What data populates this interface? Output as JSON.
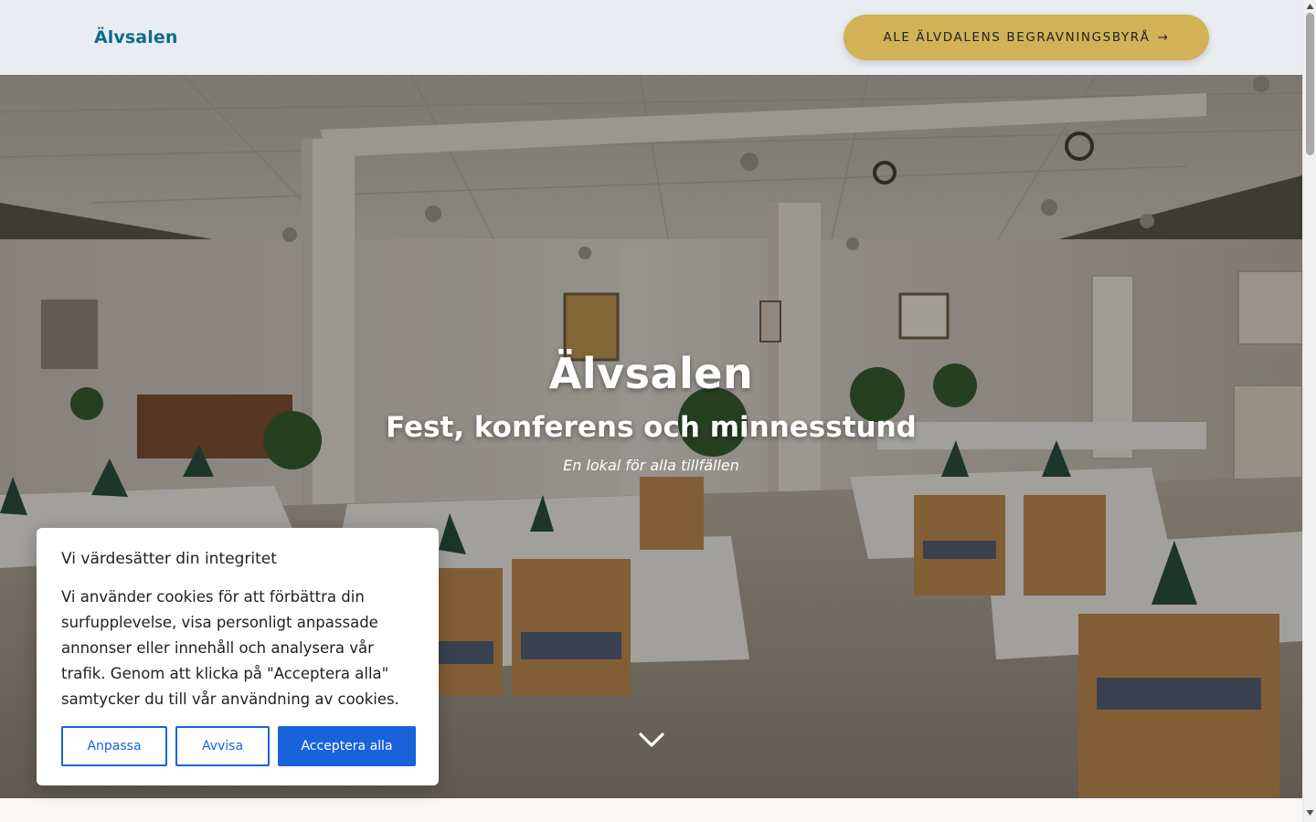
{
  "header": {
    "logo": "Älvsalen",
    "cta_label": "ALE ÄLVDALENS BEGRAVNINGSBYRÅ",
    "cta_arrow": "→",
    "cta_color": "#d2b256",
    "logo_color": "#0f6a8f"
  },
  "hero": {
    "title": "Älvsalen",
    "subtitle": "Fest, konferens och minnesstund",
    "tagline": "En lokal för alla tillfällen",
    "scroll_icon": "chevron-down-icon"
  },
  "cookie": {
    "title": "Vi värdesätter din integritet",
    "text": "Vi använder cookies för att förbättra din surfupplevelse, visa personligt anpassade annonser eller innehåll och analysera vår trafik. Genom att klicka på \"Acceptera alla\" samtycker du till vår användning av cookies.",
    "customize_label": "Anpassa",
    "reject_label": "Avvisa",
    "accept_label": "Acceptera alla",
    "accent_color": "#1863dc"
  }
}
